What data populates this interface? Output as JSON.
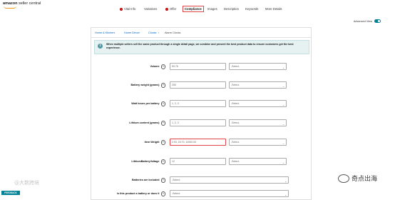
{
  "header": {
    "brand": "amazon",
    "service": "seller central"
  },
  "tabs": [
    {
      "label": "Vital Info",
      "error": true
    },
    {
      "label": "Variations",
      "error": false
    },
    {
      "label": "Offer",
      "error": true
    },
    {
      "label": "Compliance",
      "error": false,
      "active": true
    },
    {
      "label": "Images",
      "error": false
    },
    {
      "label": "Description",
      "error": false
    },
    {
      "label": "Keywords",
      "error": false
    },
    {
      "label": "More Details",
      "error": false
    }
  ],
  "advanced_view": {
    "label": "Advanced View",
    "on": true
  },
  "breadcrumb": [
    "Home & Kitchen",
    "Home Décor",
    "Clocks",
    "Alarm Clocks"
  ],
  "info_message": "When multiple sellers sell the same product through a single detail page, we combine and present the best product data to ensure customers get the best experience.",
  "fields": [
    {
      "label": "Volume",
      "value": "59.78",
      "unit": "-Select-"
    },
    {
      "label": "Battery weight (grams)",
      "value": "250",
      "unit": "-Select-"
    },
    {
      "label": "Watt hours per battery",
      "value": "1, 2, 3",
      "unit": "-Select-"
    },
    {
      "label": "Lithium content (grams)",
      "value": "1, 2, 3",
      "unit": "-Select-"
    },
    {
      "label": "Item Weight",
      "value": "2.93, 20.70, 10000.00",
      "unit": "-Select-",
      "highlight": true
    },
    {
      "label": "LithiumBatteryVoltage",
      "value": "12",
      "unit": "-Select-"
    },
    {
      "label": "Batteries are Included",
      "value": "-Select-"
    },
    {
      "label": "Is this product a battery or does it",
      "value": "-Select-"
    }
  ],
  "feedback": "FEEDBACK",
  "watermarks": {
    "left": "@大数跨境",
    "right": "奇点出海"
  }
}
